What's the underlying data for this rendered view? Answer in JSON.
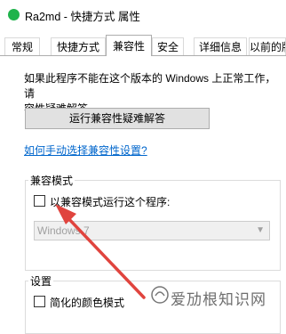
{
  "window": {
    "title": "Ra2md - 快捷方式 属性",
    "icon": "green-app-icon"
  },
  "tabs": [
    {
      "label": "常规",
      "active": false
    },
    {
      "label": "快捷方式",
      "active": false
    },
    {
      "label": "兼容性",
      "active": true
    },
    {
      "label": "安全",
      "active": false
    },
    {
      "label": "详细信息",
      "active": false
    },
    {
      "label": "以前的版",
      "active": false
    }
  ],
  "compat": {
    "intro": "如果此程序不能在这个版本的 Windows 上正常工作，请\n容性疑难解答。",
    "troubleshoot_button": "运行兼容性疑难解答",
    "manual_link": "如何手动选择兼容性设置?",
    "compat_mode_group": "兼容模式",
    "run_compat_checkbox": "以兼容模式运行这个程序:",
    "os_select_value": "Windows 7",
    "settings_group": "设置",
    "reduced_color_checkbox": "简化的颜色模式"
  },
  "watermark": {
    "text": "爱劢根知识网"
  },
  "colors": {
    "accent_link": "#0066cc",
    "annotation_arrow": "#e0443e",
    "app_icon": "#1fb34b"
  }
}
